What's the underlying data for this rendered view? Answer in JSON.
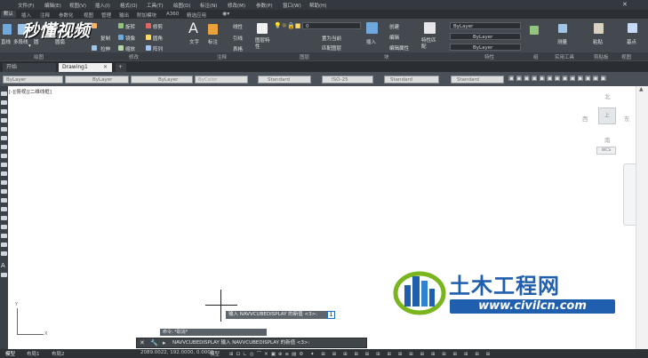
{
  "menubar": {
    "items": [
      "文件(F)",
      "编辑(E)",
      "视图(V)",
      "插入(I)",
      "格式(O)",
      "工具(T)",
      "绘图(D)",
      "标注(N)",
      "修改(M)",
      "参数(P)",
      "窗口(W)",
      "帮助(H)"
    ]
  },
  "ribbon_tabs": {
    "items": [
      "默认",
      "插入",
      "注释",
      "参数化",
      "视图",
      "管理",
      "输出",
      "附加模块",
      "A360",
      "精选应用"
    ]
  },
  "ribbon": {
    "draw": {
      "line": "直线",
      "polyline": "多段线",
      "circle": "圆",
      "arc": "圆弧"
    },
    "modify": {
      "move": "移动",
      "rotate": "旋转",
      "trim": "修剪",
      "copy": "复制",
      "mirror": "镜像",
      "fillet": "圆角",
      "stretch": "拉伸",
      "scale": "缩放",
      "array": "阵列"
    },
    "annotation": {
      "text": "文字",
      "dim": "标注",
      "linear": "线性",
      "leader": "引线",
      "table": "表格"
    },
    "layers": {
      "layer_props": "图层特性",
      "layer_value": "0",
      "make_current": "置为当前",
      "match_layer": "匹配图层"
    },
    "block": {
      "insert": "插入",
      "create": "创建",
      "edit": "编辑",
      "edit_attr": "编辑属性"
    },
    "properties": {
      "match": "特性匹配",
      "color": "ByLayer",
      "linetype": "ByLayer",
      "lineweight": "ByLayer"
    },
    "groups": {
      "group": "组"
    },
    "utilities": {
      "measure": "测量"
    },
    "clipboard": {
      "paste": "粘贴"
    },
    "view": {
      "base": "基点"
    }
  },
  "ribbon_footer": {
    "labels": [
      "绘图",
      "修改",
      "注释",
      "图层",
      "块",
      "特性",
      "组",
      "实用工具",
      "剪贴板",
      "视图"
    ]
  },
  "watermark_top": "秒懂视频",
  "doc_tabs": {
    "start": "开始",
    "drawing": "Drawing1",
    "add": "+"
  },
  "propbar": {
    "layer": "ByLayer",
    "linetype": "ByLayer",
    "lineweight": "ByLayer",
    "plotstyle": "ByColor",
    "textstyle": "Standard",
    "dimstyle": "ISO-25",
    "tablestyle": "Standard",
    "mleaderstyle": "Standard"
  },
  "canvas": {
    "viewport_label": "[-][俯视][二维线框]",
    "dyn_input": "输入 NAVVCUBEDISPLAY 的新值 <3>:",
    "dyn_value": "1",
    "ucs_y": "Y",
    "ucs_x": "X"
  },
  "viewcube": {
    "north": "北",
    "south": "南",
    "east": "东",
    "west": "西",
    "top": "上",
    "wcs": "WCS"
  },
  "command": {
    "history": "命令: *取消*",
    "current": "NAVVCUBEDISPLAY 输入 NAVVCUBEDISPLAY 的新值 <3>:"
  },
  "statusbar": {
    "model": "模型",
    "layout1": "布局1",
    "layout2": "布局2",
    "coords": "2089.0022, 192.0000, 0.0000",
    "model_btn": "模型"
  },
  "watermark": {
    "cn": "土木工程网",
    "url": "www.civilcn.com"
  },
  "colors": {
    "accent": "#1a6fc2",
    "logo_green": "#7ab51d",
    "logo_blue": "#1f5fae"
  }
}
